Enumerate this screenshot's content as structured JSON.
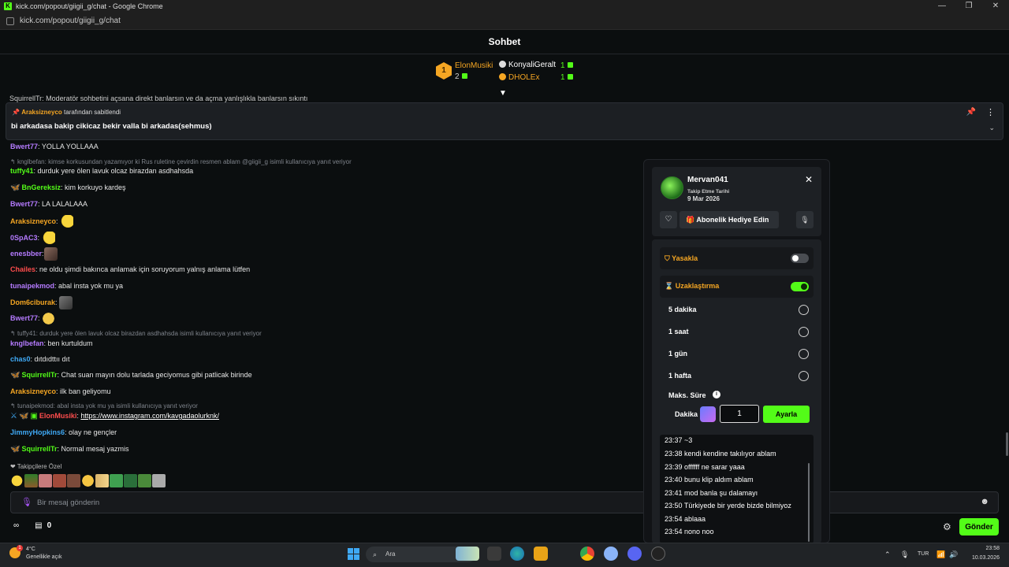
{
  "window": {
    "title": "kick.com/popout/giigii_g/chat - Google Chrome",
    "url": "kick.com/popout/giigii_g/chat",
    "controls": [
      "—",
      "❐",
      "✕"
    ]
  },
  "chat": {
    "header_title": "Sohbet",
    "leaderboard": {
      "rank": "1",
      "first": {
        "name": "ElonMusiki",
        "count": "2"
      },
      "second": {
        "name": "KonyaliGeralt",
        "count": "1"
      },
      "third": {
        "name": "DHOLEx",
        "count": "1"
      }
    },
    "pinned_strip": "SquirrellTr: Moderatör sohbetini açsana direkt banlarsın ve da açma yanlışlıkla banlarsın sıkıntı",
    "pinned": {
      "by_user": "Araksizneyco",
      "by_suffix": "tarafından sabitlendi",
      "message": "bi arkadasa bakip cikicaz bekir valla bi arkadas(sehmus)"
    },
    "messages": [
      {
        "user": "Bwert77",
        "color": "#b57bff",
        "text": ": YOLLA YOLLAAA"
      },
      {
        "reply": "knglbefan: kimse korkusundan yazamıyor ki Rus ruletine çevirdin resmen ablam @giigii_g isimli kullanıcıya yanıt veriyor"
      },
      {
        "user": "tuffy41",
        "color": "#53fc18",
        "text": ": durduk yere ölen lavuk olcaz birazdan asdhahsda"
      },
      {
        "user": "BnGereksiz",
        "color": "#53fc18",
        "text": ": kim korkuyo kardeş"
      },
      {
        "user": "Bwert77",
        "color": "#b57bff",
        "text": ": LA LALALAAA"
      },
      {
        "user": "Araksizneyco",
        "color": "#f5a623",
        "text": ":"
      },
      {
        "user": "0SpAC3",
        "color": "#b57bff",
        "text": ":"
      },
      {
        "user": "enesbber",
        "color": "#b57bff",
        "text": ":"
      },
      {
        "user": "Chailes",
        "color": "#ff4d4d",
        "text": ": ne oldu şimdi bakınca anlamak için soruyorum yalnış anlama lütfen"
      },
      {
        "user": "tunaipekmod",
        "color": "#b57bff",
        "text": ": abal insta yok mu ya"
      },
      {
        "user": "Dom6ciburak",
        "color": "#f5a623",
        "text": ":"
      },
      {
        "user": "Bwert77",
        "color": "#b57bff",
        "text": ":"
      },
      {
        "reply": "tuffy41: durduk yere ölen lavuk olcaz birazdan asdhahsda isimli kullanıcıya yanıt veriyor"
      },
      {
        "user": "knglbefan",
        "color": "#b57bff",
        "text": ": ben kurtuldum"
      },
      {
        "user": "chas0",
        "color": "#3fa9f5",
        "text": ": dıtdıdttıı dıt"
      },
      {
        "user": "SquirrellTr",
        "color": "#53fc18",
        "text": ": Chat suan mayın dolu tarlada geciyomus gibi patlicak birinde"
      },
      {
        "user": "Araksizneyco",
        "color": "#f5a623",
        "text": ": ilk ban geliyomu"
      },
      {
        "reply": "tunaipekmod: abal insta yok mu ya isimli kullanıcıya yanıt veriyor"
      },
      {
        "user": "ElonMusiki",
        "color": "#ff4d4d",
        "text": ": ",
        "link": "https://www.instagram.com/kavgadaolurknk/"
      },
      {
        "user": "JimmyHopkins6",
        "color": "#3fa9f5",
        "text": ": olay ne gençler"
      },
      {
        "user": "SquirrellTr",
        "color": "#53fc18",
        "text": ": Normal mesaj yazmis"
      }
    ],
    "followers_label": "Takipçilere Özel",
    "input_placeholder": "Bir mesaj gönderin",
    "bottom_count": "0",
    "send_label": "Gönder"
  },
  "modal": {
    "username": "Mervan041",
    "follow_label": "Takip Etme Tarihi",
    "follow_date": "9 Mar 2026",
    "gift_label": "Abonelik Hediye Edin",
    "ban_label": "Yasakla",
    "ban_enabled": false,
    "timeout_label": "Uzaklaştırma",
    "timeout_enabled": true,
    "options": [
      "5 dakika",
      "1 saat",
      "1 gün",
      "1 hafta"
    ],
    "max_label": "Maks. Süre",
    "unit_label": "Dakika",
    "minutes_value": "1",
    "apply_label": "Ayarla",
    "history": [
      "23:37 ~3",
      "23:38 kendi kendine takılıyor ablam",
      "23:39 offffff ne sarar yaaa",
      "23:40 bunu klip aldım ablam",
      "23:41 mod banla şu dalamayı",
      "23:50 Türkiyede bir yerde bizde bilmiyoz",
      "23:54 ablaaa",
      "23:54 nono noo"
    ]
  },
  "taskbar": {
    "temp": "4°C",
    "condition": "Genellikle açık",
    "weather_badge": "1",
    "search_placeholder": "Ara",
    "lang": "TUR",
    "time": "23:58",
    "date": "10.03.2026"
  },
  "colors": {
    "accent": "#53fc18",
    "warning": "#f5a623",
    "background": "#0b0e0f"
  }
}
